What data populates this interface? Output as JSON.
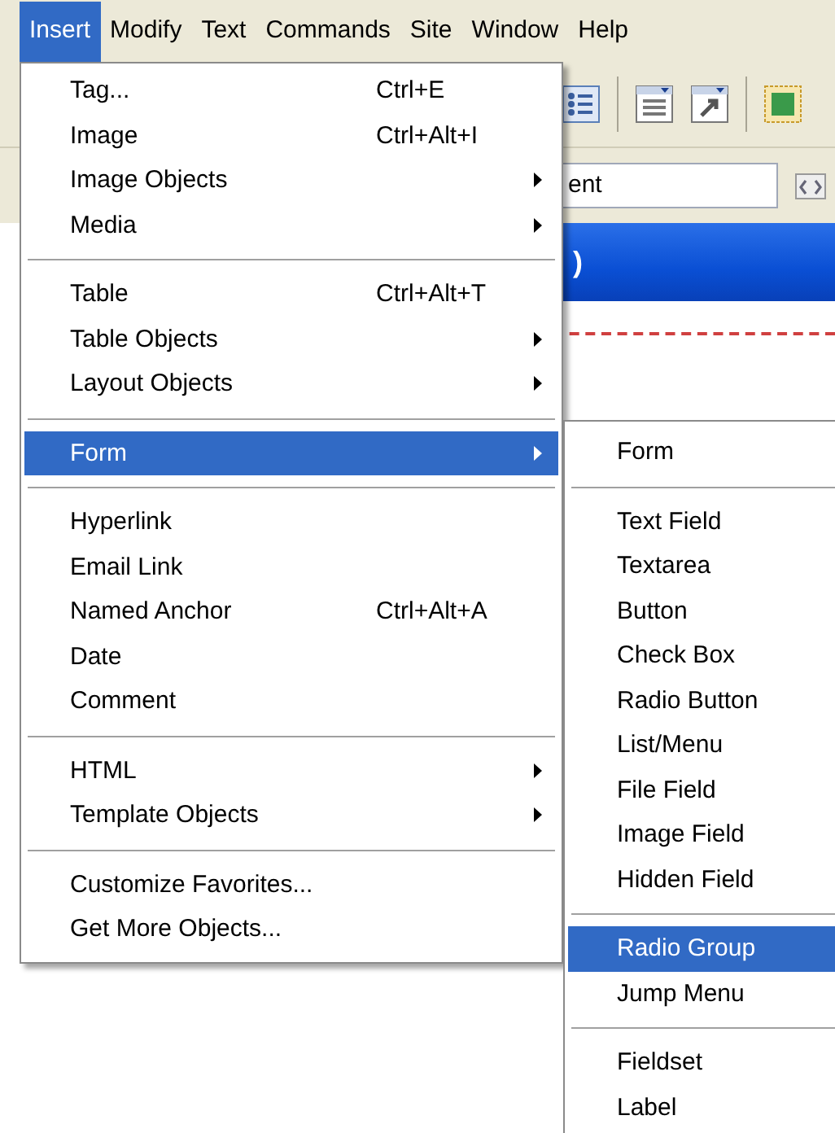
{
  "menu_bar": [
    {
      "label": "Insert",
      "selected": true
    },
    {
      "label": "Modify",
      "selected": false
    },
    {
      "label": "Text",
      "selected": false
    },
    {
      "label": "Commands",
      "selected": false
    },
    {
      "label": "Site",
      "selected": false
    },
    {
      "label": "Window",
      "selected": false
    },
    {
      "label": "Help",
      "selected": false
    }
  ],
  "document": {
    "title_field": "ent",
    "title_bar": ")"
  },
  "insert_menu": [
    {
      "kind": "item",
      "label": "Tag...",
      "shortcut": "Ctrl+E",
      "submenu": false,
      "selected": false
    },
    {
      "kind": "item",
      "label": "Image",
      "shortcut": "Ctrl+Alt+I",
      "submenu": false,
      "selected": false
    },
    {
      "kind": "item",
      "label": "Image Objects",
      "submenu": true,
      "selected": false
    },
    {
      "kind": "item",
      "label": "Media",
      "submenu": true,
      "selected": false
    },
    {
      "kind": "separator"
    },
    {
      "kind": "item",
      "label": "Table",
      "shortcut": "Ctrl+Alt+T",
      "submenu": false,
      "selected": false
    },
    {
      "kind": "item",
      "label": "Table Objects",
      "submenu": true,
      "selected": false
    },
    {
      "kind": "item",
      "label": "Layout Objects",
      "submenu": true,
      "selected": false
    },
    {
      "kind": "separator"
    },
    {
      "kind": "item",
      "label": "Form",
      "submenu": true,
      "selected": true
    },
    {
      "kind": "separator"
    },
    {
      "kind": "item",
      "label": "Hyperlink",
      "submenu": false,
      "selected": false
    },
    {
      "kind": "item",
      "label": "Email Link",
      "submenu": false,
      "selected": false
    },
    {
      "kind": "item",
      "label": "Named Anchor",
      "shortcut": "Ctrl+Alt+A",
      "submenu": false,
      "selected": false
    },
    {
      "kind": "item",
      "label": "Date",
      "submenu": false,
      "selected": false
    },
    {
      "kind": "item",
      "label": "Comment",
      "submenu": false,
      "selected": false
    },
    {
      "kind": "separator"
    },
    {
      "kind": "item",
      "label": "HTML",
      "submenu": true,
      "selected": false
    },
    {
      "kind": "item",
      "label": "Template Objects",
      "submenu": true,
      "selected": false
    },
    {
      "kind": "separator"
    },
    {
      "kind": "item",
      "label": "Customize Favorites...",
      "submenu": false,
      "selected": false
    },
    {
      "kind": "item",
      "label": "Get More Objects...",
      "submenu": false,
      "selected": false
    }
  ],
  "form_submenu": [
    {
      "kind": "item",
      "label": "Form",
      "selected": false
    },
    {
      "kind": "separator"
    },
    {
      "kind": "item",
      "label": "Text Field",
      "selected": false
    },
    {
      "kind": "item",
      "label": "Textarea",
      "selected": false
    },
    {
      "kind": "item",
      "label": "Button",
      "selected": false
    },
    {
      "kind": "item",
      "label": "Check Box",
      "selected": false
    },
    {
      "kind": "item",
      "label": "Radio Button",
      "selected": false
    },
    {
      "kind": "item",
      "label": "List/Menu",
      "selected": false
    },
    {
      "kind": "item",
      "label": "File Field",
      "selected": false
    },
    {
      "kind": "item",
      "label": "Image Field",
      "selected": false
    },
    {
      "kind": "item",
      "label": "Hidden Field",
      "selected": false
    },
    {
      "kind": "separator"
    },
    {
      "kind": "item",
      "label": "Radio Group",
      "selected": true
    },
    {
      "kind": "item",
      "label": "Jump Menu",
      "selected": false
    },
    {
      "kind": "separator"
    },
    {
      "kind": "item",
      "label": "Fieldset",
      "selected": false
    },
    {
      "kind": "item",
      "label": "Label",
      "selected": false
    }
  ]
}
